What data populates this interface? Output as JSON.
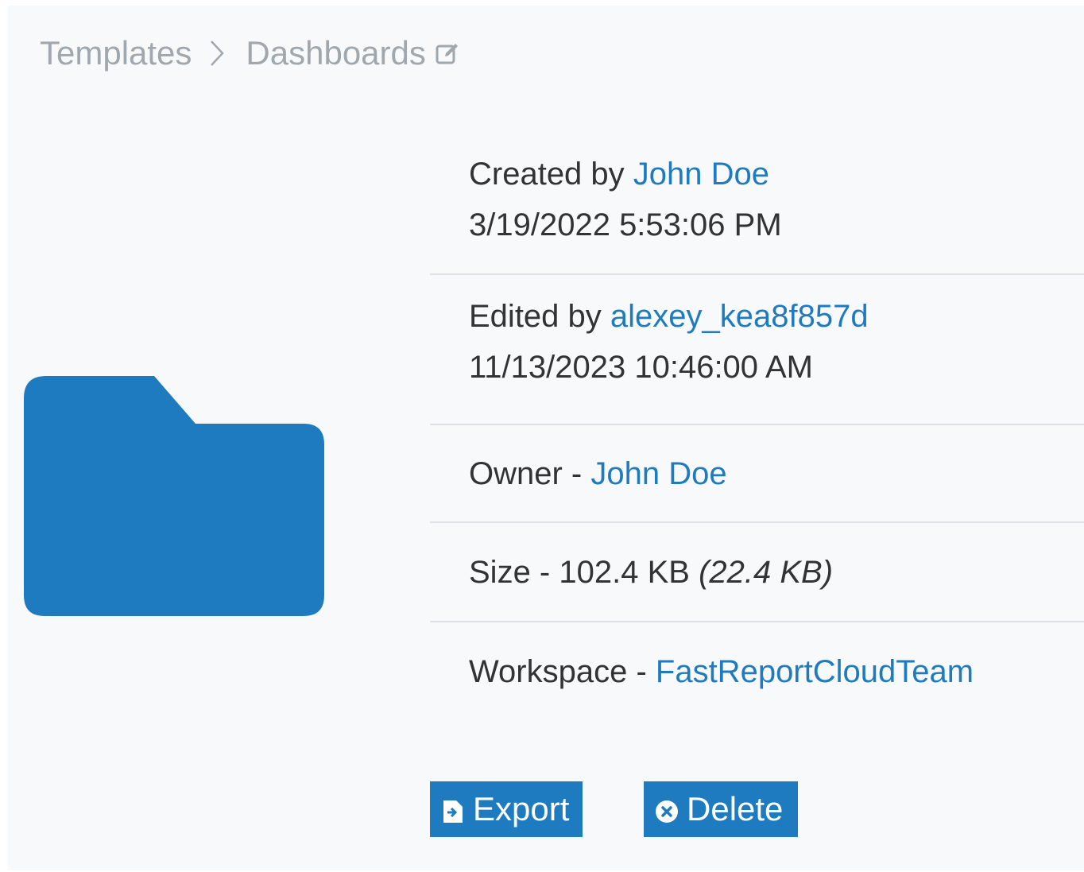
{
  "breadcrumb": {
    "root": "Templates",
    "current": "Dashboards",
    "separator_icon": "chevron-right-icon",
    "edit_icon": "edit-icon"
  },
  "folder": {
    "icon": "folder-icon",
    "color": "#1f7bbf"
  },
  "info": {
    "created": {
      "label": "Created by ",
      "user": "John Doe",
      "timestamp": "3/19/2022 5:53:06 PM"
    },
    "edited": {
      "label": "Edited by ",
      "user": "alexey_kea8f857d",
      "timestamp": "11/13/2023 10:46:00 AM"
    },
    "owner": {
      "label": "Owner - ",
      "user": "John Doe"
    },
    "size": {
      "label": "Size - ",
      "value": "102.4 KB",
      "secondary": "(22.4 KB)"
    },
    "workspace": {
      "label": "Workspace - ",
      "name": "FastReportCloudTeam"
    }
  },
  "actions": {
    "export_label": "Export",
    "export_icon": "export-icon",
    "delete_label": "Delete",
    "delete_icon": "delete-circle-icon"
  },
  "colors": {
    "accent": "#1f7bbf",
    "breadcrumb_text": "#a0a7ad",
    "body_text": "#333333",
    "panel_bg": "#f8f9fb",
    "divider": "#dfe2e5"
  }
}
